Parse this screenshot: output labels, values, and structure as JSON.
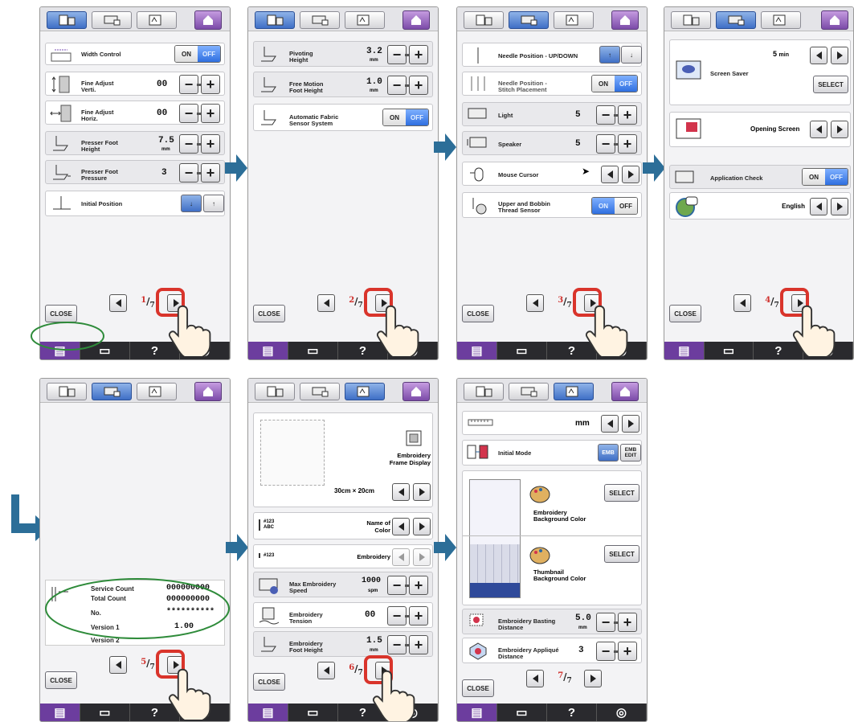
{
  "accent": "#6c3d9e",
  "highlight": "#d9342b",
  "icons": [
    "settings-page-icon",
    "machine-icon",
    "embroidery-icon",
    "home-icon",
    "arrow-right-icon",
    "hand-pointer-icon",
    "help-icon"
  ],
  "common": {
    "close": "CLOSE",
    "help": "?",
    "on": "ON",
    "off": "OFF",
    "select": "SELECT",
    "total": "7"
  },
  "p1": {
    "page": "1",
    "rows": [
      {
        "label": "Width Control",
        "ctrl": "onoff",
        "state": "off"
      },
      {
        "label": "Fine Adjust\nVerti.",
        "value": "00"
      },
      {
        "label": "Fine Adjust\nHoriz.",
        "value": "00"
      },
      {
        "label": "Presser Foot\nHeight",
        "value": "7.5",
        "unit": "mm"
      },
      {
        "label": "Presser Foot\nPressure",
        "value": "3"
      },
      {
        "label": "Initial Position"
      }
    ]
  },
  "p2": {
    "page": "2",
    "rows": [
      {
        "label": "Pivoting\nHeight",
        "value": "3.2",
        "unit": "mm"
      },
      {
        "label": "Free Motion\nFoot Height",
        "value": "1.0",
        "unit": "mm"
      },
      {
        "label": "Automatic Fabric\nSensor System",
        "ctrl": "onoff",
        "state": "off"
      }
    ]
  },
  "p3": {
    "page": "3",
    "rows": [
      {
        "label": "Needle Position - UP/DOWN"
      },
      {
        "label": "Needle Position -\nStitch Placement",
        "ctrl": "onoff",
        "state": "off"
      },
      {
        "label": "Light",
        "value": "5"
      },
      {
        "label": "Speaker",
        "value": "5"
      },
      {
        "label": "Mouse Cursor"
      },
      {
        "label": "Upper and Bobbin\nThread Sensor",
        "ctrl": "onoff",
        "state": "on"
      }
    ]
  },
  "p4": {
    "page": "4",
    "screen_saver": "Screen Saver",
    "saver_time": "5",
    "saver_unit": "min",
    "opening": "Opening Screen",
    "app_check": "Application Check",
    "language": "English"
  },
  "p5": {
    "page": "5",
    "rows": [
      {
        "label": "Service Count",
        "value": "000000000"
      },
      {
        "label": "Total Count",
        "value": "000000000"
      },
      {
        "label": "No.",
        "value": "**********"
      },
      {
        "label": "Version 1",
        "value": "1.00"
      },
      {
        "label": "Version 2",
        "value": ""
      }
    ]
  },
  "p6": {
    "page": "6",
    "frame_display": "Embroidery\nFrame Display",
    "frame_size": "30cm × ",
    "frame_size2": "20cm",
    "name_of_color": "Name of\nColor",
    "color_tag": "#123\nABC",
    "color_tag2": "#123",
    "embroidery": "Embroidery",
    "rows": [
      {
        "label": "Max Embroidery\nSpeed",
        "value": "1000",
        "unit": "spm"
      },
      {
        "label": "Embroidery\nTension",
        "value": "00"
      },
      {
        "label": "Embroidery\nFoot Height",
        "value": "1.5",
        "unit": "mm"
      }
    ]
  },
  "p7": {
    "page": "7",
    "unit": "mm",
    "initial_mode": "Initial Mode",
    "emb": "EMB",
    "emb_edit": "EMB\nEDIT",
    "bg_color": "Embroidery\nBackground Color",
    "thumb_color": "Thumbnail\nBackground Color",
    "rows": [
      {
        "label": "Embroidery Basting\nDistance",
        "value": "5.0",
        "unit": "mm"
      },
      {
        "label": "Embroidery Appliqué\nDistance",
        "value": "3"
      }
    ]
  }
}
